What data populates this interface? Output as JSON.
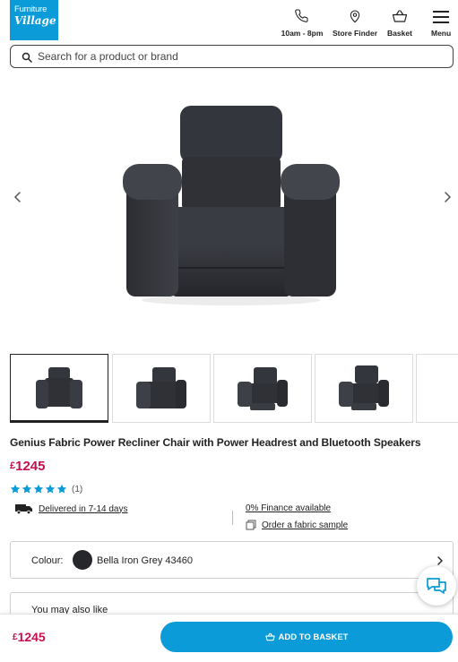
{
  "header": {
    "logo_line1": "Furniture",
    "logo_line2": "Village",
    "phone_label": "10am - 8pm",
    "store_label": "Store Finder",
    "basket_label": "Basket",
    "menu_label": "Menu"
  },
  "search": {
    "placeholder": "Search for a product or brand"
  },
  "product": {
    "title": "Genius Fabric Power Recliner Chair with Power Headrest and Bluetooth Speakers",
    "currency": "£",
    "price": "1245",
    "rating": 5,
    "rating_count": "(1)",
    "delivery": "Delivered in 7-14 days",
    "finance": "0% Finance available",
    "sample": "Order a fabric sample"
  },
  "colour": {
    "label": "Colour:",
    "value": "Bella Iron Grey 43460",
    "swatch": "#26272b"
  },
  "also_like": {
    "title": "You may also like"
  },
  "sticky": {
    "currency": "£",
    "price": "1245",
    "button_label": "ADD TO BASKET"
  },
  "thumbnails": [
    "front",
    "angled",
    "reclined",
    "reclined-headrest",
    "side"
  ],
  "colors": {
    "brand": "#0a9bd8",
    "price": "#c4104d",
    "stars": "#0a9bd8"
  }
}
